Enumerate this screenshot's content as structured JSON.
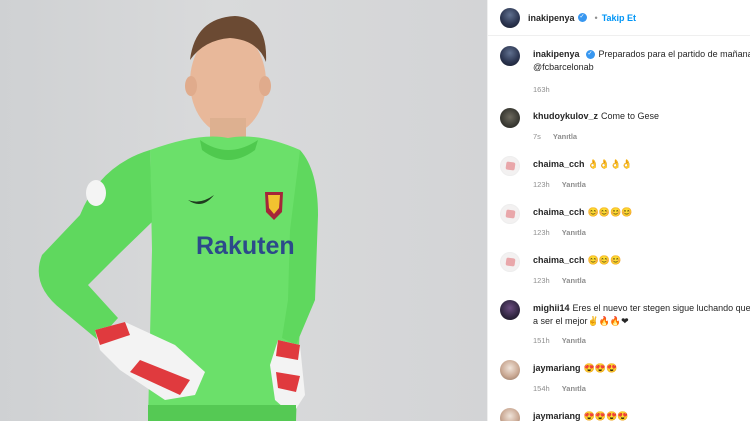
{
  "header": {
    "username": "inakipenya",
    "verified_icon": "verified-badge-icon",
    "separator": "•",
    "follow_label": "Takip Et"
  },
  "caption": {
    "username": "inakipenya",
    "text": "Preparados para el partido de mañana",
    "mention": "@fcbarcelonab",
    "time": "163h"
  },
  "reply_label": "Yanıtla",
  "comments": [
    {
      "username": "khudoykulov_z",
      "text": "Come to Gese",
      "time": "7s"
    },
    {
      "username": "chaima_cch",
      "text": "👌👌👌👌",
      "time": "123h"
    },
    {
      "username": "chaima_cch",
      "text": "😊😊😊😊",
      "time": "123h"
    },
    {
      "username": "chaima_cch",
      "text": "😊😊😊",
      "time": "123h"
    },
    {
      "username": "mighii14",
      "text": "Eres el nuevo ter stegen sigue luchando que",
      "text2": "a ser el mejor✌🔥🔥❤",
      "time": "151h"
    },
    {
      "username": "jaymariang",
      "text": "😍😍😍",
      "time": "154h"
    },
    {
      "username": "jaymariang",
      "text": "😍😍😍😍"
    }
  ],
  "photo": {
    "sponsor_text": "Rakuten"
  },
  "colors": {
    "accent": "#0095f6",
    "jersey": "#6be06a",
    "verified": "#3897f0"
  }
}
